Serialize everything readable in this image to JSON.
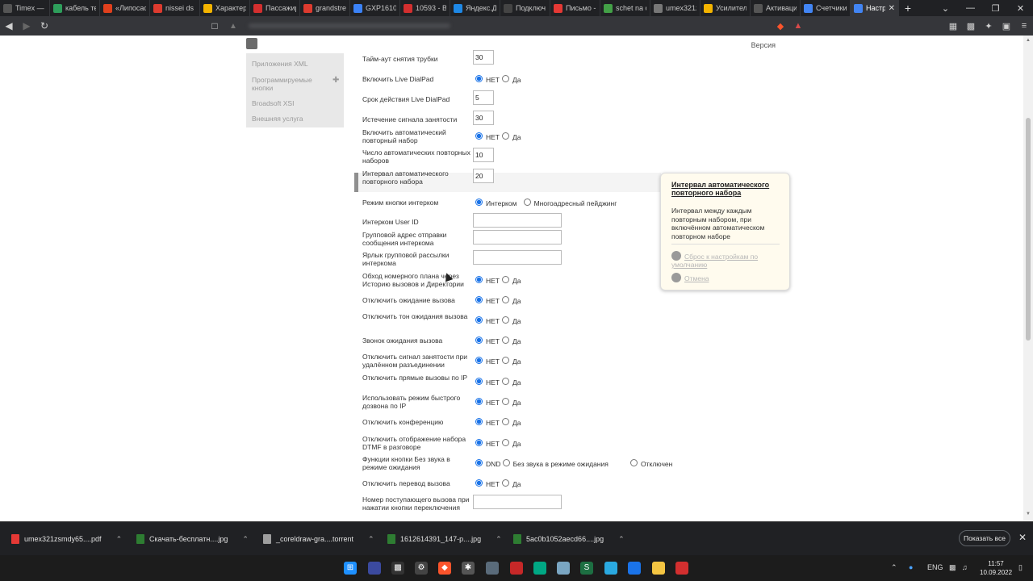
{
  "tabs": [
    {
      "label": "Timex — I",
      "icon": "timex-icon",
      "color": "#555555"
    },
    {
      "label": "кабель те",
      "icon": "site-icon",
      "color": "#2e9e5b"
    },
    {
      "label": "«Липосас",
      "icon": "site-icon",
      "color": "#e0401d"
    },
    {
      "label": "nissei ds 5",
      "icon": "google-icon",
      "color": "#dd3b2f"
    },
    {
      "label": "Характер",
      "icon": "site-icon",
      "color": "#f4b400"
    },
    {
      "label": "Пассажир",
      "icon": "site-icon",
      "color": "#d32f2f"
    },
    {
      "label": "grandstre",
      "icon": "google-icon",
      "color": "#dd3b2f"
    },
    {
      "label": "GXP1610_",
      "icon": "site-icon",
      "color": "#3b82f6"
    },
    {
      "label": "10593 - Вс",
      "icon": "mail-icon",
      "color": "#d32f2f"
    },
    {
      "label": "Яндекс.Ди",
      "icon": "site-icon",
      "color": "#1e88e5"
    },
    {
      "label": "Подключ",
      "icon": "plus-icon",
      "color": "#444444"
    },
    {
      "label": "Письмо -",
      "icon": "mail-icon",
      "color": "#e53935"
    },
    {
      "label": "schet na c",
      "icon": "site-icon",
      "color": "#43a047"
    },
    {
      "label": "umex321z",
      "icon": "site-icon",
      "color": "#777777"
    },
    {
      "label": "Усилител",
      "icon": "site-icon",
      "color": "#f4b400"
    },
    {
      "label": "Активаци",
      "icon": "site-icon",
      "color": "#555555"
    },
    {
      "label": "Счетчики",
      "icon": "site-icon",
      "color": "#4285f4"
    },
    {
      "label": "Настр",
      "icon": "site-icon",
      "color": "#4285f4",
      "active": true
    }
  ],
  "header": {
    "version_label": "Версия"
  },
  "sidebar": {
    "items": [
      {
        "label": "Приложения XML"
      },
      {
        "label": "Программируемые кнопки"
      },
      {
        "label": "Broadsoft XSI"
      },
      {
        "label": "Внешняя услуга"
      }
    ]
  },
  "form": {
    "rows": [
      {
        "label": "Тайм-аут снятия трубки",
        "type": "input",
        "value": "30"
      },
      {
        "label": "Включить Live DialPad",
        "type": "radio",
        "options": [
          "НЕТ",
          "Да"
        ],
        "selected": 0
      },
      {
        "label": "Срок действия Live DialPad",
        "type": "input",
        "value": "5"
      },
      {
        "label": "Истечение сигнала занятости",
        "type": "input",
        "value": "30"
      },
      {
        "label": "Включить автоматический повторный набор",
        "type": "radio",
        "options": [
          "НЕТ",
          "Да"
        ],
        "selected": 0
      },
      {
        "label": "Число автоматических повторных наборов",
        "type": "input",
        "value": "10"
      },
      {
        "label": "Интервал автоматического повторного набора",
        "type": "input",
        "value": "20"
      },
      {
        "label": "Режим кнопки интерком",
        "type": "radio",
        "options": [
          "Интерком",
          "Многоадресный пейджинг"
        ],
        "selected": 0
      },
      {
        "label": "Интерком User ID",
        "type": "input",
        "value": ""
      },
      {
        "label": "Групповой адрес отправки сообщения интеркома",
        "type": "input",
        "value": ""
      },
      {
        "label": "Ярлык групповой рассылки интеркома",
        "type": "input",
        "value": ""
      },
      {
        "label": "Обход номерного плана через Историю вызовов и Директории",
        "type": "radio",
        "options": [
          "НЕТ",
          "Да"
        ],
        "selected": 0
      },
      {
        "label": "Отключить ожидание вызова",
        "type": "radio",
        "options": [
          "НЕТ",
          "Да"
        ],
        "selected": 0
      },
      {
        "label": "Отключить тон ожидания вызова",
        "type": "radio",
        "options": [
          "НЕТ",
          "Да"
        ],
        "selected": 0
      },
      {
        "label": "Звонок ожидания вызова",
        "type": "radio",
        "options": [
          "НЕТ",
          "Да"
        ],
        "selected": 0
      },
      {
        "label": "Отключить сигнал занятости при удалённом разъединении",
        "type": "radio",
        "options": [
          "НЕТ",
          "Да"
        ],
        "selected": 0
      },
      {
        "label": "Отключить прямые вызовы по IP",
        "type": "radio",
        "options": [
          "НЕТ",
          "Да"
        ],
        "selected": 0
      },
      {
        "label": "Использовать режим быстрого дозвона по IP",
        "type": "radio",
        "options": [
          "НЕТ",
          "Да"
        ],
        "selected": 0
      },
      {
        "label": "Отключить конференцию",
        "type": "radio",
        "options": [
          "НЕТ",
          "Да"
        ],
        "selected": 0
      },
      {
        "label": "Отключить отображение набора DTMF в разговоре",
        "type": "radio",
        "options": [
          "НЕТ",
          "Да"
        ],
        "selected": 0
      },
      {
        "label": "Функции кнопки Без звука в режиме ожидания",
        "type": "radio",
        "options": [
          "DND",
          "Без звука в режиме ожидания",
          "Отключен"
        ],
        "selected": 0
      },
      {
        "label": "Отключить перевод вызова",
        "type": "radio",
        "options": [
          "НЕТ",
          "Да"
        ],
        "selected": 0
      },
      {
        "label": "Номер поступающего вызова при нажатии кнопки переключения",
        "type": "input",
        "value": ""
      }
    ]
  },
  "tooltip": {
    "title": "Интервал автоматического повторного набора",
    "body": "Интервал между каждым повторным набором, при включённом автоматическом повторном наборе",
    "reset_label": "Сброс к настройкам по умолчанию",
    "cancel_label": "Отмена"
  },
  "downloads": {
    "items": [
      {
        "label": "umex321zsmdy65....pdf",
        "icon": "pdf-icon",
        "color": "#e53935"
      },
      {
        "label": "Скачать-бесплатн....jpg",
        "icon": "image-icon",
        "color": "#2e7d32"
      },
      {
        "label": "_coreldraw-gra....torrent",
        "icon": "file-icon",
        "color": "#9e9e9e"
      },
      {
        "label": "1612614391_147-p....jpg",
        "icon": "image-icon",
        "color": "#2e7d32"
      },
      {
        "label": "5ac0b1052aecd66....jpg",
        "icon": "image-icon",
        "color": "#2e7d32"
      }
    ],
    "show_all": "Показать все"
  },
  "taskbar": {
    "language": "ENG",
    "time": "11:57",
    "date": "10.09.2022"
  }
}
